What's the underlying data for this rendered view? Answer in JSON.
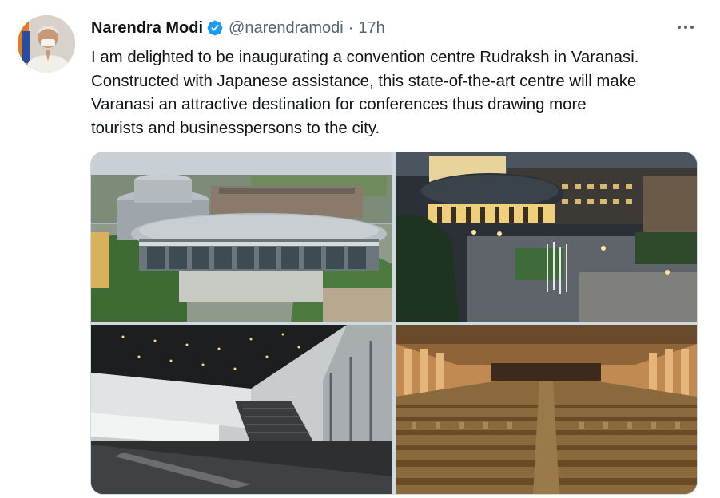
{
  "author": {
    "name": "Narendra Modi",
    "handle": "@narendramodi",
    "time": "17h",
    "verified": true,
    "verified_icon": "verified-badge-icon",
    "verified_color": "#1d9bf0"
  },
  "tweet": {
    "text_lines": [
      "I am delighted to be inaugurating a convention centre Rudraksh in Varanasi.",
      "Constructed with Japanese assistance, this state-of-the-art centre will make",
      "Varanasi an attractive destination for conferences thus drawing more",
      "tourists and businesspersons to the city."
    ]
  },
  "actions": {
    "more_icon": "more-options-icon"
  },
  "media": [
    {
      "icon": "building-exterior-day-photo"
    },
    {
      "icon": "building-exterior-night-photo"
    },
    {
      "icon": "atrium-staircase-photo"
    },
    {
      "icon": "auditorium-seats-photo"
    }
  ],
  "colors": {
    "text": "#0f1419",
    "secondary": "#536471",
    "border": "#cfd9de"
  }
}
